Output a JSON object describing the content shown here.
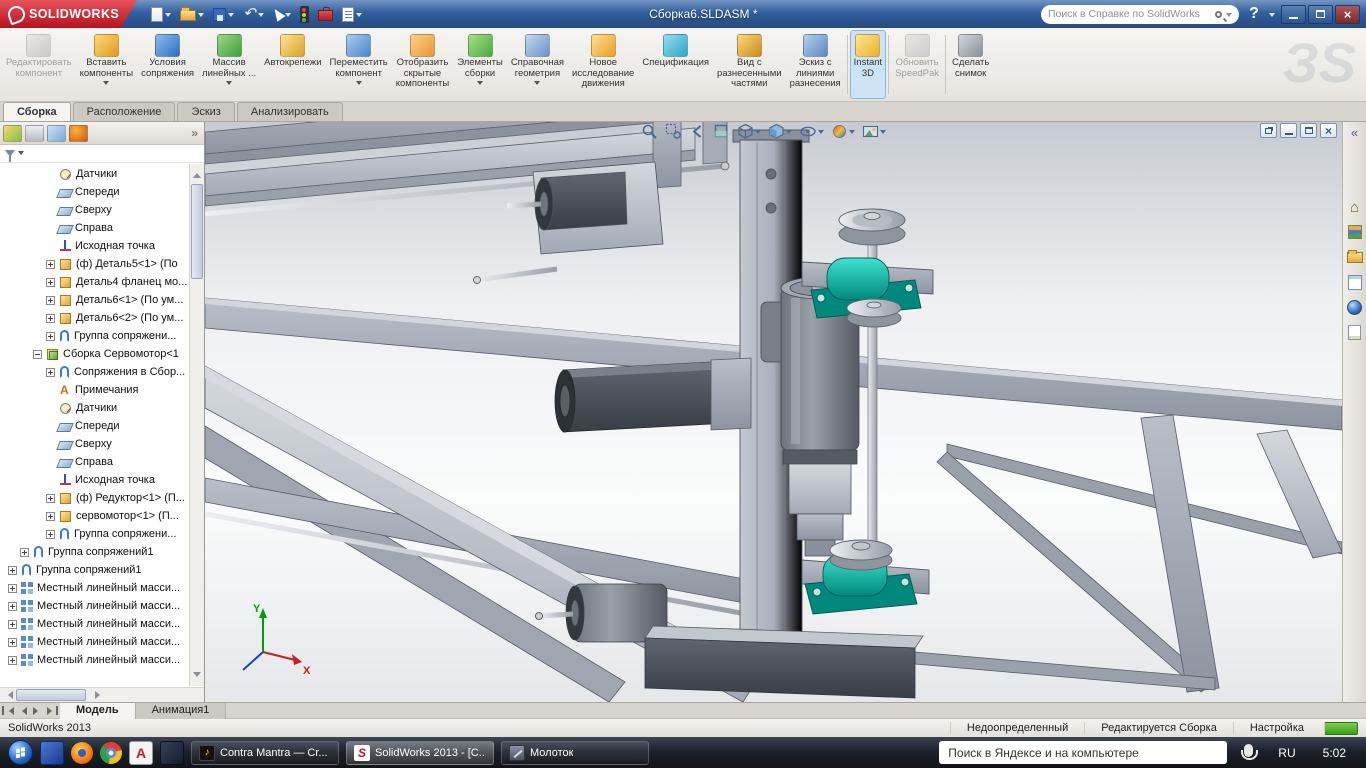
{
  "colors": {
    "brand_red": "#c8102e",
    "titlebar_blue": "#33609f",
    "bearing_teal": "#00b3a4",
    "taskbar_dark": "#171b21",
    "active_tool_blue": "#cfe3f6"
  },
  "titlebar": {
    "brand": "SOLIDWORKS",
    "document_title": "Сборка6.SLDASM *",
    "search_placeholder": "Поиск в Справке по SolidWorks"
  },
  "ribbon": {
    "buttons": [
      {
        "label": "Редактировать\nкомпонент"
      },
      {
        "label": "Вставить\nкомпоненты"
      },
      {
        "label": "Условия\nсопряжения"
      },
      {
        "label": "Массив\nлинейных ..."
      },
      {
        "label": "Автокрепежи"
      },
      {
        "label": "Переместить\nкомпонент"
      },
      {
        "label": "Отобразить\nскрытые\nкомпоненты"
      },
      {
        "label": "Элементы\nсборки"
      },
      {
        "label": "Справочная\nгеометрия"
      },
      {
        "label": "Новое\nисследование\nдвижения"
      },
      {
        "label": "Спецификация"
      },
      {
        "label": "Вид с\nразнесенными\nчастями"
      },
      {
        "label": "Эскиз с\nлиниями\nразнесения"
      },
      {
        "label": "Instant\n3D"
      },
      {
        "label": "Обновить\nSpeedPak"
      },
      {
        "label": "Сделать\nснимок"
      }
    ]
  },
  "command_tabs": [
    "Сборка",
    "Расположение",
    "Эскиз",
    "Анализировать"
  ],
  "feature_tree": {
    "items": [
      {
        "label": "Датчики"
      },
      {
        "label": "Спереди"
      },
      {
        "label": "Сверху"
      },
      {
        "label": "Справа"
      },
      {
        "label": "Исходная точка"
      },
      {
        "label": "(ф) Деталь5<1> (По"
      },
      {
        "label": "Деталь4 фланец мо..."
      },
      {
        "label": "Деталь6<1> (По ум..."
      },
      {
        "label": "Деталь6<2> (По ум..."
      },
      {
        "label": "Группа сопряжени..."
      },
      {
        "label": "Сборка Сервомотор<1"
      },
      {
        "label": "Сопряжения в Сбор..."
      },
      {
        "label": "Примечания"
      },
      {
        "label": "Датчики"
      },
      {
        "label": "Спереди"
      },
      {
        "label": "Сверху"
      },
      {
        "label": "Справа"
      },
      {
        "label": "Исходная точка"
      },
      {
        "label": "(ф) Редуктор<1> (П..."
      },
      {
        "label": "сервомотор<1> (П..."
      },
      {
        "label": "Группа сопряжени..."
      },
      {
        "label": "Группа сопряжений1"
      },
      {
        "label": "Группа сопряжений1"
      },
      {
        "label": "Местный линейный масси..."
      },
      {
        "label": "Местный линейный масси..."
      },
      {
        "label": "Местный линейный масси..."
      },
      {
        "label": "Местный линейный масси..."
      },
      {
        "label": "Местный линейный масси..."
      }
    ]
  },
  "viewport": {
    "axis_y": "Y",
    "axis_x": "X"
  },
  "model_tabs": [
    "Модель",
    "Анимация1"
  ],
  "statusbar": {
    "app_version": "SolidWorks 2013",
    "constraint_status": "Недоопределенный",
    "edit_status": "Редактируется Сборка",
    "customize": "Настройка"
  },
  "taskbar": {
    "tasks": [
      {
        "label": "Contra Mantra — Cr..."
      },
      {
        "label": "SolidWorks 2013 - [C..."
      },
      {
        "label": "Молоток"
      }
    ],
    "search_placeholder": "Поиск в Яндексе и на компьютере",
    "language": "RU",
    "time": "5:02"
  }
}
